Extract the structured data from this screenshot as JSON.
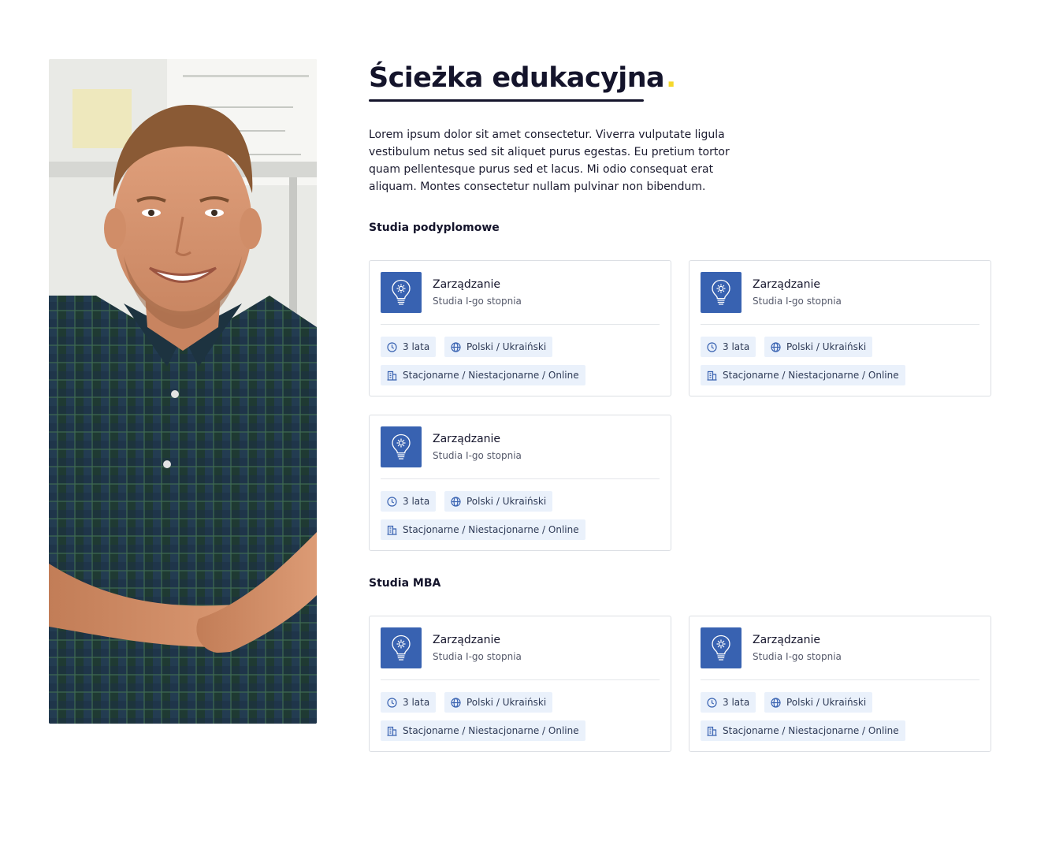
{
  "page": {
    "title": "Ścieżka edukacyjna",
    "title_dot": ".",
    "intro": "Lorem ipsum dolor sit amet consectetur. Viverra vulputate ligula vestibulum netus sed sit aliquet purus egestas. Eu pretium tortor quam pellentesque purus sed et lacus. Mi odio consequat erat aliquam. Montes consectetur nullam pulvinar non bibendum."
  },
  "colors": {
    "accent_dot": "#f5d82c",
    "icon_tile": "#3862b1",
    "chip_bg": "#eaf1fb",
    "heading": "#14142b"
  },
  "sections": [
    {
      "title": "Studia podyplomowe",
      "cards": [
        {
          "icon": "lightbulb-gear-icon",
          "title": "Zarządzanie",
          "subtitle": "Studia I-go stopnia",
          "duration": "3 lata",
          "languages": "Polski / Ukraiński",
          "mode": "Stacjonarne / Niestacjonarne / Online"
        },
        {
          "icon": "lightbulb-gear-icon",
          "title": "Zarządzanie",
          "subtitle": "Studia I-go stopnia",
          "duration": "3 lata",
          "languages": "Polski / Ukraiński",
          "mode": "Stacjonarne / Niestacjonarne / Online"
        },
        {
          "icon": "lightbulb-gear-icon",
          "title": "Zarządzanie",
          "subtitle": "Studia I-go stopnia",
          "duration": "3 lata",
          "languages": "Polski / Ukraiński",
          "mode": "Stacjonarne / Niestacjonarne / Online"
        }
      ]
    },
    {
      "title": "Studia MBA",
      "cards": [
        {
          "icon": "lightbulb-gear-icon",
          "title": "Zarządzanie",
          "subtitle": "Studia I-go stopnia",
          "duration": "3 lata",
          "languages": "Polski / Ukraiński",
          "mode": "Stacjonarne / Niestacjonarne / Online"
        },
        {
          "icon": "lightbulb-gear-icon",
          "title": "Zarządzanie",
          "subtitle": "Studia I-go stopnia",
          "duration": "3 lata",
          "languages": "Polski / Ukraiński",
          "mode": "Stacjonarne / Niestacjonarne / Online"
        }
      ]
    }
  ],
  "chip_icons": {
    "duration": "clock-icon",
    "languages": "globe-icon",
    "mode": "building-icon"
  }
}
